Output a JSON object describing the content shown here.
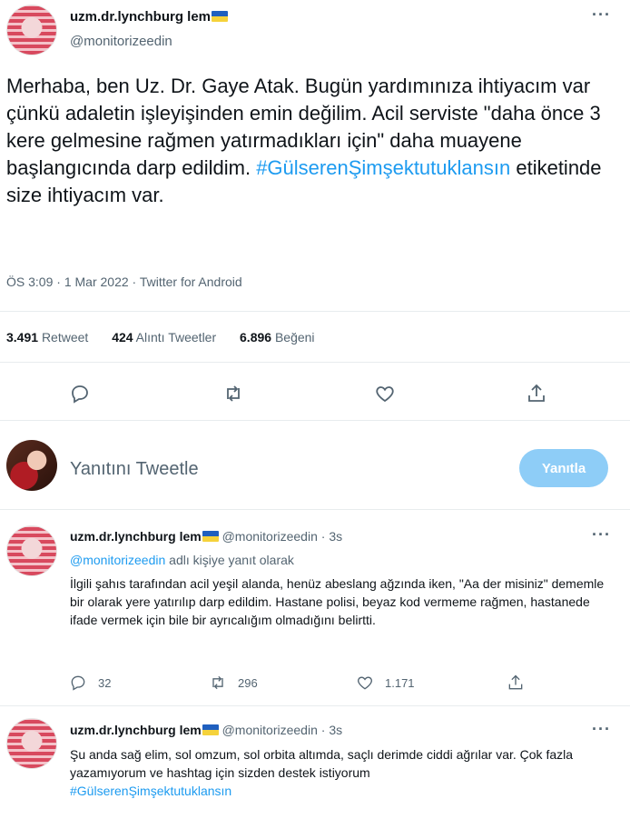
{
  "main_tweet": {
    "display_name": "uzm.dr.lynchburg lem",
    "handle": "@monitorizeedin",
    "text_part1": "Merhaba, ben Uz. Dr. Gaye Atak. Bugün yardımınıza ihtiyacım var çünkü adaletin işleyişinden emin değilim. Acil serviste \"daha önce 3 kere gelmesine rağmen yatırmadıkları için\" daha muayene başlangıcında darp edildim.",
    "hashtag": "#GülserenŞimşektutuklansın",
    "text_part2": "etiketinde size ihtiyacım var.",
    "time": "ÖS 3:09",
    "date": "1 Mar 2022",
    "source": "Twitter for Android",
    "retweets_count": "3.491",
    "retweets_label": "Retweet",
    "quotes_count": "424",
    "quotes_label": "Alıntı Tweetler",
    "likes_count": "6.896",
    "likes_label": "Beğeni"
  },
  "composer": {
    "placeholder": "Yanıtını Tweetle",
    "button_label": "Yanıtla"
  },
  "replies": [
    {
      "display_name": "uzm.dr.lynchburg lem",
      "handle": "@monitorizeedin",
      "time": "3s",
      "reply_to_handle": "@monitorizeedin",
      "reply_to_suffix": "adlı kişiye yanıt olarak",
      "text": "İlgili şahıs tarafından acil yeşil alanda, henüz abeslang ağzında iken, \"Aa der misiniz\" dememle bir olarak yere yatırılıp darp edildim. Hastane polisi, beyaz kod vermeme rağmen, hastanede ifade vermek için bile bir ayrıcalığım olmadığını belirtti.",
      "reply_count": "32",
      "retweet_count": "296",
      "like_count": "1.171"
    },
    {
      "display_name": "uzm.dr.lynchburg lem",
      "handle": "@monitorizeedin",
      "time": "3s",
      "text": "Şu anda sağ elim, sol omzum, sol orbita altımda, saçlı derimde ciddi ağrılar var. Çok fazla yazamıyorum ve hashtag için sizden destek istiyorum",
      "hashtag": "#GülserenŞimşektutuklansın"
    }
  ],
  "icons": {
    "more": "more-icon",
    "reply": "reply-icon",
    "retweet": "retweet-icon",
    "like": "heart-icon",
    "share": "share-icon",
    "flag": "ukraine-flag-icon"
  },
  "colors": {
    "accent": "#1d9bf0",
    "button_disabled": "#8ecdf7",
    "secondary_text": "#536471"
  }
}
